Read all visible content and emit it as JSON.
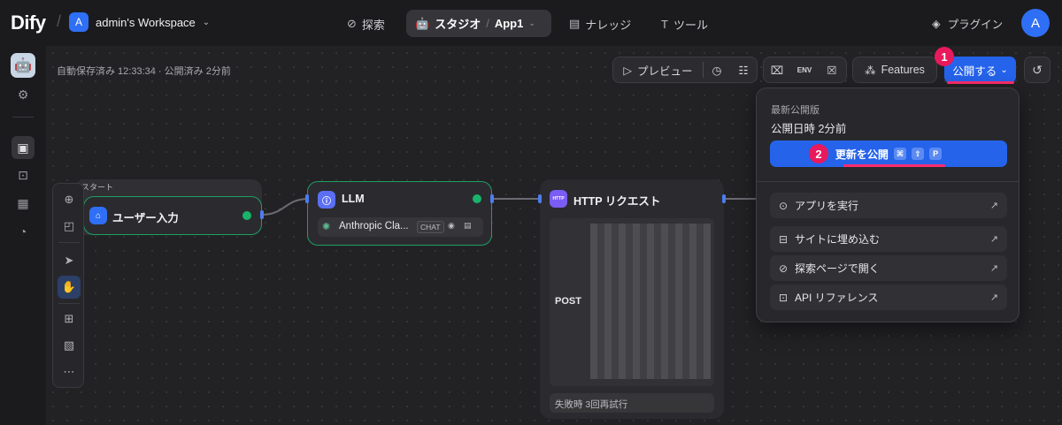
{
  "topbar": {
    "logo": "Dify",
    "workspace_initial": "A",
    "workspace_name": "admin's Workspace",
    "nav_explore": "探索",
    "nav_studio": "スタジオ",
    "app_name": "App1",
    "nav_knowledge": "ナレッジ",
    "nav_tools": "ツール",
    "plugins": "プラグイン",
    "user_initial": "A"
  },
  "canvas": {
    "status_text": "自動保存済み 12:33:34 · 公開済み 2分前"
  },
  "toolbar": {
    "preview_label": "プレビュー",
    "env_label": "ENV",
    "features_label": "Features",
    "publish_label": "公開する",
    "badge_1": "1",
    "badge_2": "2"
  },
  "publish_menu": {
    "latest_label": "最新公開版",
    "published_time": "公開日時 2分前",
    "update_label": "更新を公開",
    "shortcut_keys": [
      "⌘",
      "⇧",
      "P"
    ],
    "items": [
      {
        "icon": "play-circle-icon",
        "label": "アプリを実行"
      },
      {
        "icon": "embed-icon",
        "label": "サイトに埋め込む"
      },
      {
        "icon": "explore-icon",
        "label": "探索ページで開く"
      },
      {
        "icon": "terminal-icon",
        "label": "API リファレンス"
      }
    ]
  },
  "nodes": {
    "start": {
      "group_label": "スタート",
      "title": "ユーザー入力"
    },
    "llm": {
      "title": "LLM",
      "model": "Anthropic Cla...",
      "mode": "CHAT"
    },
    "http": {
      "icon_text": "HTTP",
      "title": "HTTP リクエスト",
      "method": "POST",
      "footer": "失敗時 3回再試行"
    }
  },
  "colors": {
    "accent": "#2563eb",
    "highlight": "#e8195c",
    "success": "#19b36b"
  }
}
